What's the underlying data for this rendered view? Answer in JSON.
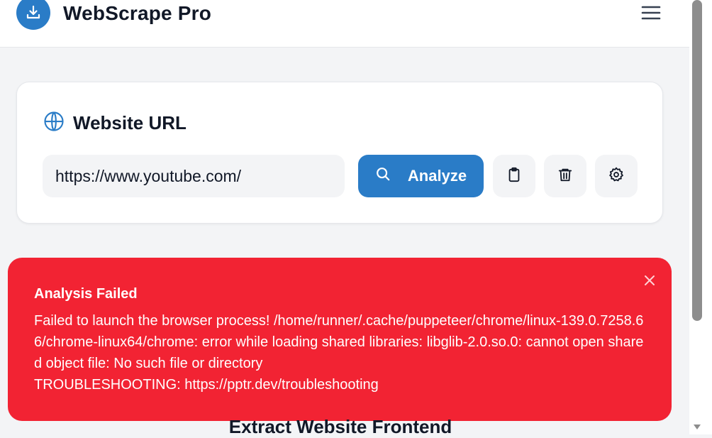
{
  "header": {
    "title": "WebScrape Pro",
    "logo_icon": "download-icon",
    "menu_icon": "hamburger-menu-icon"
  },
  "url_card": {
    "title": "Website URL",
    "title_icon": "globe-icon",
    "input_value": "https://www.youtube.com/",
    "analyze_label": "Analyze",
    "analyze_icon": "search-icon",
    "action_icons": [
      "clipboard-icon",
      "trash-icon",
      "gear-icon"
    ]
  },
  "alert": {
    "title": "Analysis Failed",
    "message": "Failed to launch the browser process! /home/runner/.cache/puppeteer/chrome/linux-139.0.7258.66/chrome-linux64/chrome: error while loading shared libraries: libglib-2.0.so.0: cannot open shared object file: No such file or directory",
    "troubleshooting": "TROUBLESHOOTING: https://pptr.dev/troubleshooting",
    "close_icon": "close-icon"
  },
  "section": {
    "heading": "Extract Website Frontend"
  },
  "colors": {
    "brand": "#2a7cc7",
    "error": "#f22333",
    "background": "#f3f4f6"
  }
}
